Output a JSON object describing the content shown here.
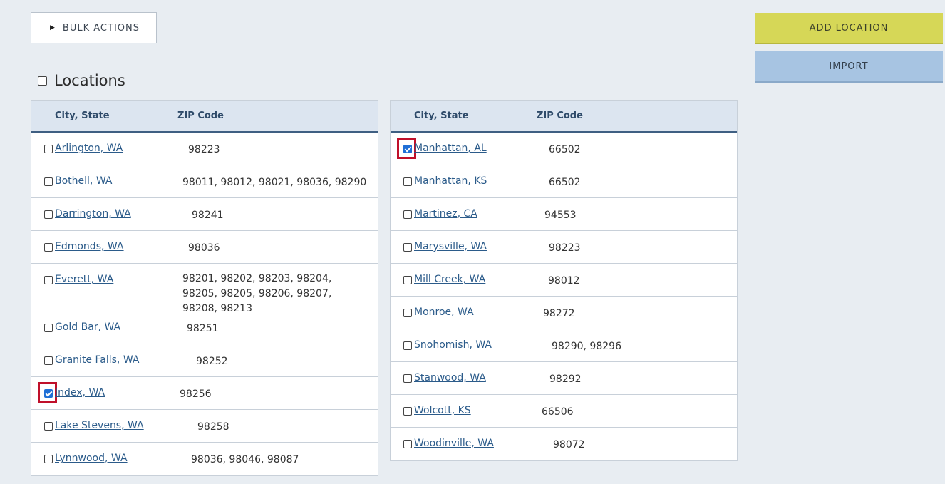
{
  "toolbar": {
    "bulk_actions_label": "BULK ACTIONS",
    "add_location_label": "ADD LOCATION",
    "import_label": "IMPORT"
  },
  "section": {
    "title": "Locations"
  },
  "table_headers": {
    "city_state": "City, State",
    "zip_code": "ZIP Code"
  },
  "left_rows": [
    {
      "city": "Arlington, WA",
      "zip": "98223",
      "checked": false
    },
    {
      "city": "Bothell, WA",
      "zip": "98011, 98012, 98021, 98036, 98290",
      "checked": false
    },
    {
      "city": "Darrington, WA",
      "zip": "98241",
      "checked": false
    },
    {
      "city": "Edmonds, WA",
      "zip": "98036",
      "checked": false
    },
    {
      "city": "Everett, WA",
      "zip": "98201, 98202, 98203, 98204, 98205, 98205, 98206, 98207, 98208, 98213",
      "checked": false
    },
    {
      "city": "Gold Bar, WA",
      "zip": "98251",
      "checked": false
    },
    {
      "city": "Granite Falls, WA",
      "zip": "98252",
      "checked": false
    },
    {
      "city": "Index, WA",
      "zip": "98256",
      "checked": true
    },
    {
      "city": "Lake Stevens, WA",
      "zip": "98258",
      "checked": false
    },
    {
      "city": "Lynnwood, WA",
      "zip": "98036, 98046, 98087",
      "checked": false
    }
  ],
  "right_rows": [
    {
      "city": "Manhattan, AL",
      "zip": "66502",
      "checked": true
    },
    {
      "city": "Manhattan, KS",
      "zip": "66502",
      "checked": false
    },
    {
      "city": "Martinez, CA",
      "zip": "94553",
      "checked": false
    },
    {
      "city": "Marysville, WA",
      "zip": "98223",
      "checked": false
    },
    {
      "city": "Mill Creek, WA",
      "zip": "98012",
      "checked": false
    },
    {
      "city": "Monroe, WA",
      "zip": "98272",
      "checked": false
    },
    {
      "city": "Snohomish, WA",
      "zip": "98290, 98296",
      "checked": false
    },
    {
      "city": "Stanwood, WA",
      "zip": "98292",
      "checked": false
    },
    {
      "city": "Wolcott, KS",
      "zip": "66506",
      "checked": false
    },
    {
      "city": "Woodinville, WA",
      "zip": "98072",
      "checked": false
    }
  ],
  "colors": {
    "add_button": "#d6d757",
    "import_button": "#a7c4e2",
    "highlight": "#c0102a",
    "link": "#2b5b8a"
  }
}
